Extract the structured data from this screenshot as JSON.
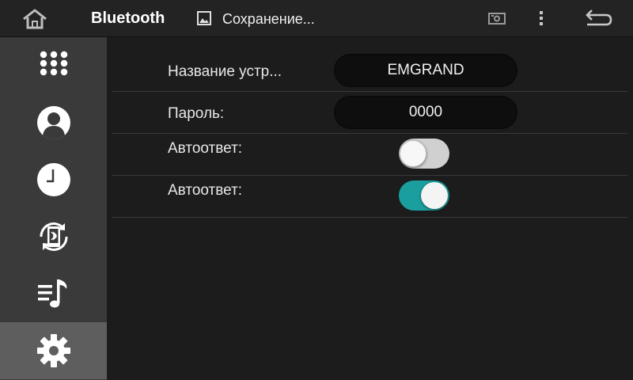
{
  "statusbar": {
    "home_icon": "home-icon",
    "app_title": "Bluetooth",
    "notification_icon": "image-icon",
    "notification_text": "Сохранение...",
    "screenshot_icon": "screenshot-icon",
    "menu_icon": "more-vert-icon",
    "back_icon": "back-icon"
  },
  "sidebar": {
    "items": [
      {
        "icon": "dialpad-icon",
        "active": false
      },
      {
        "icon": "contacts-icon",
        "active": false
      },
      {
        "icon": "clock-icon",
        "active": false
      },
      {
        "icon": "phone-sync-icon",
        "active": false
      },
      {
        "icon": "music-list-icon",
        "active": false
      },
      {
        "icon": "gear-icon",
        "active": true
      }
    ]
  },
  "settings": {
    "device_name": {
      "label": "Название устр...",
      "value": "EMGRAND"
    },
    "password": {
      "label": "Пароль:",
      "value": "0000"
    },
    "autoanswer_1": {
      "label": "Автоответ:",
      "state": "off"
    },
    "autoanswer_2": {
      "label": "Автоответ:",
      "state": "on"
    }
  },
  "colors": {
    "accent": "#1b9e9e",
    "sidebar_bg": "#3a3a3a",
    "sidebar_active": "#5e5e5e",
    "background": "#1c1c1c"
  }
}
